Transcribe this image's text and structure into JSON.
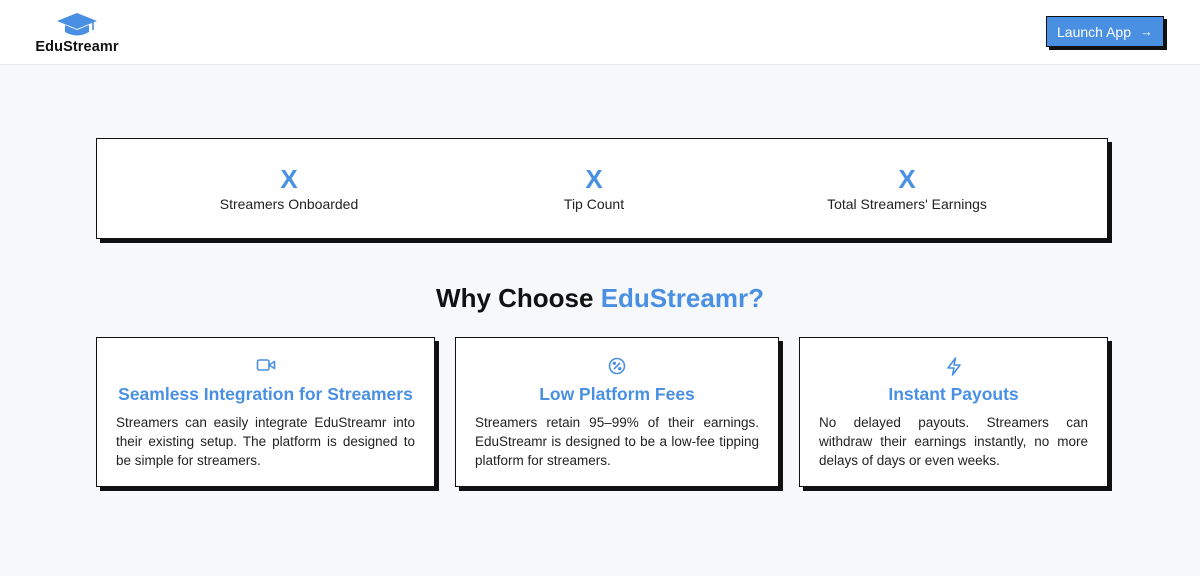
{
  "header": {
    "logo_text": "EduStreamr",
    "launch_button_label": "Launch App",
    "launch_button_icon": "arrow-right-icon"
  },
  "stats": [
    {
      "value": "X",
      "label": "Streamers Onboarded"
    },
    {
      "value": "X",
      "label": "Tip Count"
    },
    {
      "value": "X",
      "label": "Total Streamers' Earnings"
    }
  ],
  "why": {
    "title_prefix": "Why Choose ",
    "title_accent": "EduStreamr?"
  },
  "features": [
    {
      "icon": "video-camera-icon",
      "title": "Seamless Integration for Streamers",
      "description": "Streamers can easily integrate EduStreamr into their existing setup. The platform is designed to be simple for streamers."
    },
    {
      "icon": "percent-badge-icon",
      "title": "Low Platform Fees",
      "description": "Streamers retain 95–99% of their earnings. EduStreamr is designed to be a low-fee tipping platform for streamers."
    },
    {
      "icon": "lightning-icon",
      "title": "Instant Payouts",
      "description": "No delayed payouts. Streamers can withdraw their earnings instantly, no more delays of days or even weeks."
    }
  ],
  "colors": {
    "accent": "#4a90e2",
    "border": "#111111",
    "background": "#f7f8fa"
  }
}
